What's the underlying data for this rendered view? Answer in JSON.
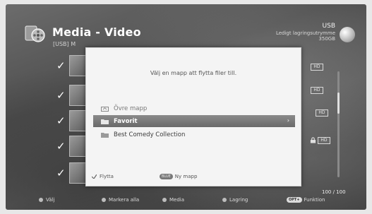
{
  "header": {
    "title": "Media - Video",
    "subtitle": "[USB] M",
    "storage_device": "USB",
    "storage_label": "Ledigt lagringsutrymme",
    "storage_size": "350GB"
  },
  "list": {
    "counter": "100 / 100",
    "badges": [
      "HD",
      "HD",
      "HD",
      "HD"
    ]
  },
  "dialog": {
    "message": "Välj en mapp att flytta filer till.",
    "folders": [
      {
        "label": "Övre mapp",
        "icon": "folder-up-icon"
      },
      {
        "label": "Favorit",
        "icon": "folder-icon",
        "selected": true
      },
      {
        "label": "Best Comedy Collection",
        "icon": "folder-icon"
      }
    ],
    "footer": {
      "move_label": "Flytta",
      "new_folder_key": "BLUE",
      "new_folder_label": "Ny mapp"
    }
  },
  "legend": {
    "select": "Välj",
    "mark_all": "Markera alla",
    "media": "Media",
    "storage": "Lagring",
    "option_key": "OPT+",
    "function": "Funktion"
  }
}
